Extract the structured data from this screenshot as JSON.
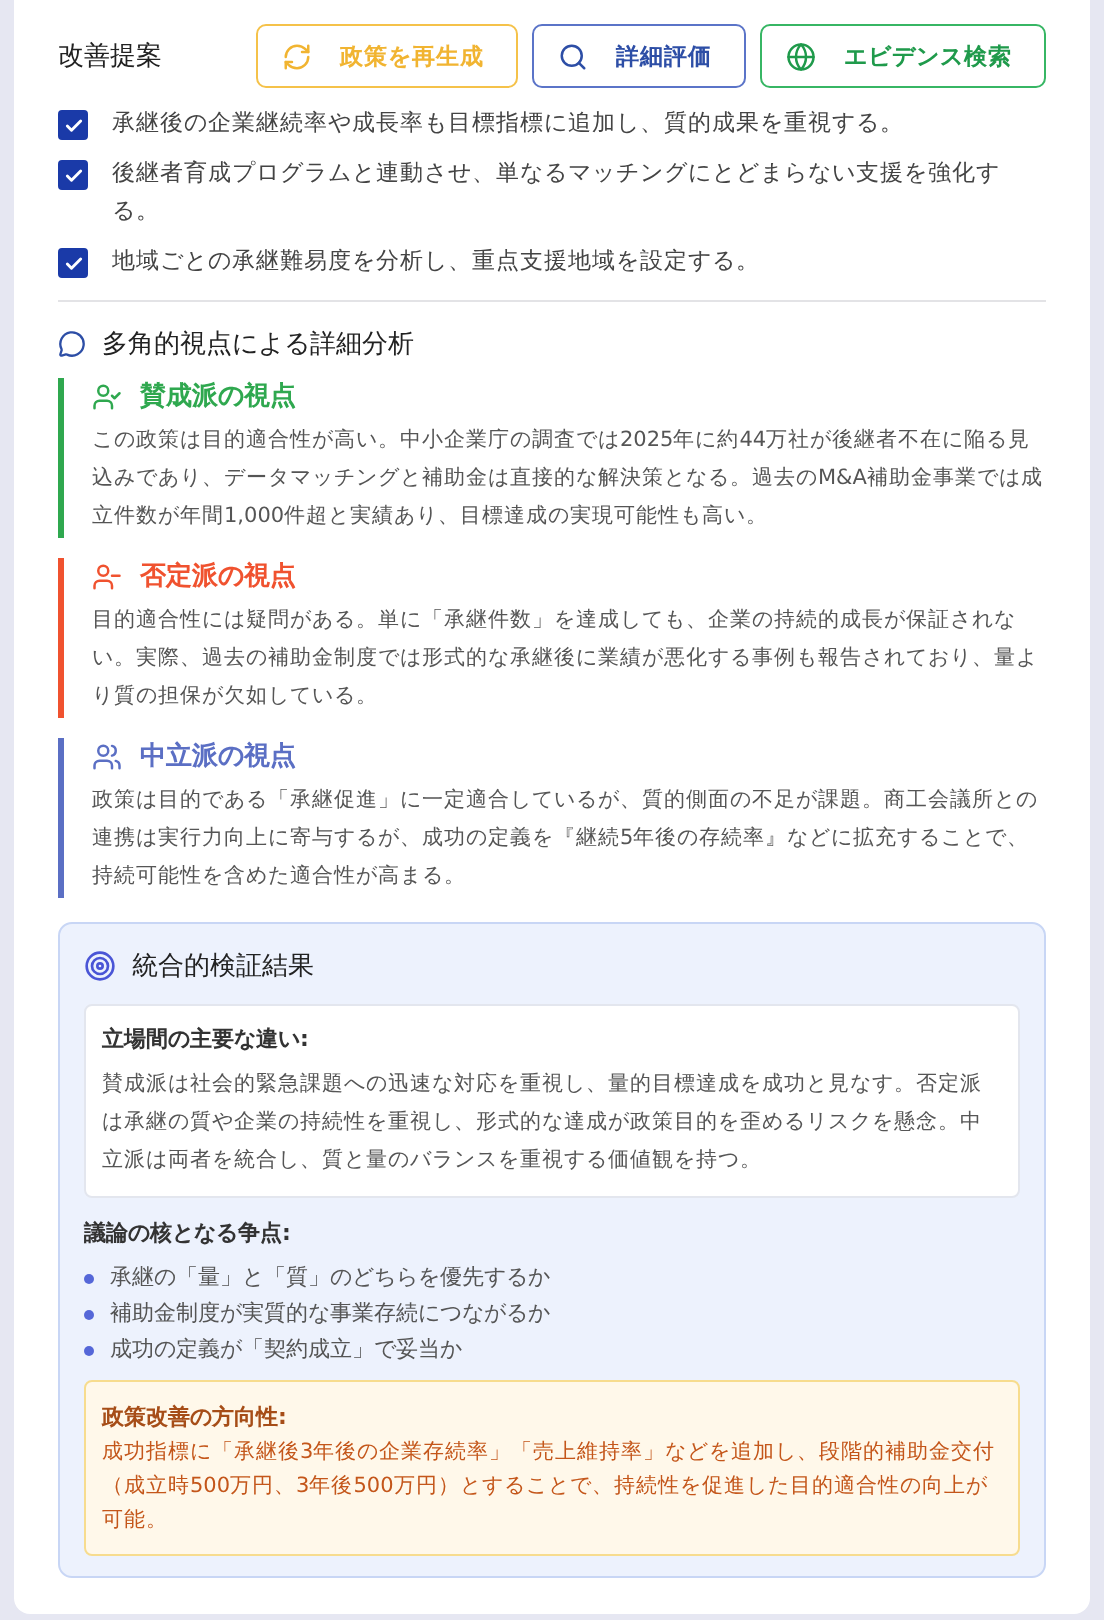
{
  "suggestions": {
    "title": "改善提案",
    "buttons": [
      {
        "kind": "regenerate",
        "label": "政策を再生成"
      },
      {
        "kind": "evaluate",
        "label": "詳細評価"
      },
      {
        "kind": "evidence",
        "label": "エビデンス検索"
      }
    ],
    "items": [
      {
        "text": "承継後の企業継続率や成長率も目標指標に追加し、質的成果を重視する。",
        "checked": true
      },
      {
        "text": "後継者育成プログラムと連動させ、単なるマッチングにとどまらない支援を強化する。",
        "checked": true
      },
      {
        "text": "地域ごとの承継難易度を分析し、重点支援地域を設定する。",
        "checked": true
      }
    ]
  },
  "analysis": {
    "title": "多角的視点による詳細分析",
    "perspectives": [
      {
        "kind": "pro",
        "color": "#2fa84f",
        "title": "賛成派の視点",
        "text": "この政策は目的適合性が高い。中小企業庁の調査では2025年に約44万社が後継者不在に陥る見込みであり、データマッチングと補助金は直接的な解決策となる。過去のM&A補助金事業では成立件数が年間1,000件超と実績あり、目標達成の実現可能性も高い。"
      },
      {
        "kind": "con",
        "color": "#f0522f",
        "title": "否定派の視点",
        "text": "目的適合性には疑問がある。単に「承継件数」を達成しても、企業の持続的成長が保証されない。実際、過去の補助金制度では形式的な承継後に業績が悪化する事例も報告されており、量より質の担保が欠如している。"
      },
      {
        "kind": "neutral",
        "color": "#5b6fc4",
        "title": "中立派の視点",
        "text": "政策は目的である「承継促進」に一定適合しているが、質的側面の不足が課題。商工会議所との連携は実行力向上に寄与するが、成功の定義を『継続5年後の存続率』などに拡充することで、持続可能性を含めた適合性が高まる。"
      }
    ]
  },
  "result": {
    "title": "統合的検証結果",
    "differences": {
      "heading": "立場間の主要な違い:",
      "text": "賛成派は社会的緊急課題への迅速な対応を重視し、量的目標達成を成功と見なす。否定派は承継の質や企業の持続性を重視し、形式的な達成が政策目的を歪めるリスクを懸念。中立派は両者を統合し、質と量のバランスを重視する価値観を持つ。"
    },
    "issues": {
      "heading": "議論の核となる争点:",
      "items": [
        "承継の「量」と「質」のどちらを優先するか",
        "補助金制度が実質的な事業存続につながるか",
        "成功の定義が「契約成立」で妥当か"
      ]
    },
    "direction": {
      "heading": "政策改善の方向性:",
      "text": "成功指標に「承継後3年後の企業存続率」「売上維持率」などを追加し、段階的補助金交付（成立時500万円、3年後500万円）とすることで、持続性を促進した目的適合性の向上が可能。"
    }
  }
}
